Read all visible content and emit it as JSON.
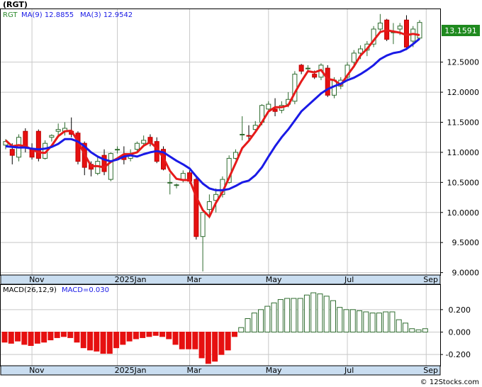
{
  "chart_data": [
    {
      "type": "candlestick",
      "title": "(RGT)",
      "legend": [
        {
          "label": "RGT",
          "color": "#2e8b2e"
        },
        {
          "label": "MA(9)",
          "value": "12.8855",
          "color": "#1a1ae6"
        },
        {
          "label": "MA(3)",
          "value": "12.9542",
          "color": "#1a1ae6"
        }
      ],
      "last_price": "13.1591",
      "y_ticks": [
        "9.0000",
        "9.5000",
        "10.0000",
        "10.5000",
        "11.0000",
        "11.5000",
        "12.0000",
        "12.5000"
      ],
      "ylim": [
        8.96,
        13.38
      ],
      "x_labels": [
        "Nov",
        "2025Jan",
        "Mar",
        "May",
        "Jul",
        "Sep"
      ],
      "candles": [
        [
          11.12,
          11.22,
          11.05,
          11.18
        ],
        [
          11.05,
          11.15,
          10.8,
          10.95
        ],
        [
          10.92,
          11.3,
          10.85,
          11.25
        ],
        [
          11.35,
          11.4,
          11.0,
          11.1
        ],
        [
          11.05,
          11.15,
          10.88,
          10.92
        ],
        [
          11.35,
          11.38,
          10.85,
          10.9
        ],
        [
          10.9,
          11.2,
          10.88,
          11.15
        ],
        [
          11.25,
          11.3,
          11.18,
          11.28
        ],
        [
          11.35,
          11.48,
          11.28,
          11.38
        ],
        [
          11.35,
          11.5,
          11.28,
          11.4
        ],
        [
          11.35,
          11.58,
          11.25,
          11.3
        ],
        [
          11.32,
          11.35,
          10.8,
          10.85
        ],
        [
          11.15,
          11.18,
          10.62,
          10.75
        ],
        [
          10.8,
          10.85,
          10.6,
          10.72
        ],
        [
          10.65,
          10.95,
          10.62,
          10.85
        ],
        [
          10.95,
          11.05,
          10.62,
          10.68
        ],
        [
          10.55,
          11.0,
          10.52,
          10.98
        ],
        [
          11.05,
          11.1,
          10.98,
          11.05
        ],
        [
          10.95,
          11.1,
          10.8,
          10.88
        ],
        [
          10.9,
          11.05,
          10.85,
          10.98
        ],
        [
          11.05,
          11.18,
          11.0,
          11.15
        ],
        [
          11.15,
          11.28,
          11.1,
          11.2
        ],
        [
          11.25,
          11.3,
          11.1,
          11.15
        ],
        [
          11.18,
          11.25,
          10.82,
          10.85
        ],
        [
          11.05,
          11.1,
          10.7,
          10.72
        ],
        [
          10.5,
          10.65,
          10.3,
          10.5
        ],
        [
          10.45,
          10.48,
          10.4,
          10.46
        ],
        [
          10.55,
          10.7,
          10.5,
          10.65
        ],
        [
          10.66,
          10.7,
          10.48,
          10.52
        ],
        [
          10.55,
          10.6,
          9.55,
          9.6
        ],
        [
          9.6,
          10.0,
          9.02,
          10.0
        ],
        [
          10.05,
          10.3,
          9.9,
          10.18
        ],
        [
          10.2,
          10.4,
          10.0,
          10.3
        ],
        [
          10.3,
          10.6,
          10.25,
          10.55
        ],
        [
          10.5,
          10.95,
          10.48,
          10.9
        ],
        [
          10.9,
          11.05,
          10.88,
          11.0
        ],
        [
          11.3,
          11.6,
          11.2,
          11.3
        ],
        [
          11.28,
          11.45,
          11.2,
          11.27
        ],
        [
          11.38,
          11.52,
          11.35,
          11.45
        ],
        [
          11.5,
          11.8,
          11.45,
          11.78
        ],
        [
          11.72,
          11.85,
          11.7,
          11.8
        ],
        [
          11.72,
          11.9,
          11.6,
          11.68
        ],
        [
          11.7,
          11.85,
          11.65,
          11.78
        ],
        [
          11.8,
          12.0,
          11.75,
          11.88
        ],
        [
          11.85,
          12.35,
          11.8,
          12.3
        ],
        [
          12.45,
          12.47,
          12.3,
          12.35
        ],
        [
          12.4,
          12.45,
          12.35,
          12.4
        ],
        [
          12.3,
          12.36,
          12.22,
          12.25
        ],
        [
          12.25,
          12.48,
          12.2,
          12.45
        ],
        [
          12.4,
          12.45,
          11.92,
          11.95
        ],
        [
          11.95,
          12.25,
          11.9,
          12.2
        ],
        [
          12.1,
          12.25,
          12.05,
          12.2
        ],
        [
          12.25,
          12.5,
          12.2,
          12.45
        ],
        [
          12.5,
          12.7,
          12.45,
          12.65
        ],
        [
          12.65,
          12.78,
          12.55,
          12.72
        ],
        [
          12.7,
          12.85,
          12.6,
          12.8
        ],
        [
          12.8,
          13.1,
          12.75,
          13.05
        ],
        [
          13.05,
          13.3,
          13.0,
          13.15
        ],
        [
          13.2,
          13.22,
          12.85,
          12.88
        ],
        [
          13.0,
          13.15,
          12.8,
          13.0
        ],
        [
          13.05,
          13.15,
          12.95,
          13.1
        ],
        [
          13.2,
          13.28,
          12.7,
          12.75
        ],
        [
          12.85,
          13.1,
          12.75,
          13.05
        ],
        [
          12.9,
          13.2,
          12.88,
          13.16
        ]
      ],
      "series": [
        {
          "name": "MA(9)",
          "color": "#1a1ae6",
          "values": [
            11.1,
            11.09,
            11.08,
            11.08,
            11.06,
            11.05,
            11.06,
            11.09,
            11.14,
            11.22,
            11.22,
            11.18,
            11.1,
            11.0,
            10.93,
            10.88,
            10.85,
            10.88,
            10.93,
            10.95,
            10.93,
            10.97,
            11.0,
            11.02,
            11.0,
            10.93,
            10.86,
            10.8,
            10.73,
            10.6,
            10.48,
            10.4,
            10.37,
            10.37,
            10.39,
            10.44,
            10.5,
            10.53,
            10.62,
            10.75,
            10.93,
            11.1,
            11.25,
            11.38,
            11.53,
            11.68,
            11.78,
            11.88,
            11.98,
            12.05,
            12.1,
            12.14,
            12.2,
            12.24,
            12.3,
            12.37,
            12.45,
            12.55,
            12.61,
            12.65,
            12.67,
            12.72,
            12.8,
            12.89
          ]
        },
        {
          "name": "MA(3)",
          "color": "#e61a1a",
          "values": [
            11.2,
            11.1,
            11.12,
            11.1,
            11.05,
            11.0,
            10.99,
            11.11,
            11.27,
            11.35,
            11.36,
            11.18,
            10.97,
            10.77,
            10.77,
            10.75,
            10.84,
            10.9,
            10.97,
            10.97,
            11.0,
            11.11,
            11.17,
            11.07,
            10.91,
            10.69,
            10.56,
            10.54,
            10.54,
            10.26,
            10.04,
            9.93,
            10.16,
            10.34,
            10.58,
            10.82,
            11.07,
            11.19,
            11.34,
            11.5,
            11.68,
            11.75,
            11.75,
            11.78,
            11.99,
            12.18,
            12.35,
            12.33,
            12.37,
            12.22,
            12.2,
            12.12,
            12.28,
            12.43,
            12.61,
            12.72,
            12.86,
            13.0,
            13.03,
            13.01,
            12.99,
            12.95,
            12.97,
            12.95
          ]
        }
      ]
    },
    {
      "type": "bar",
      "title": "MACD(26,12,9)",
      "legend": [
        {
          "label": "MACD(26,12,9)",
          "color": "#1a1ae6"
        },
        {
          "label": "MACD=0.030",
          "color": "#1a1ae6"
        }
      ],
      "y_ticks": [
        "0.200",
        "0.000",
        "-0.200"
      ],
      "ylim": [
        -0.3,
        0.42
      ],
      "x_labels": [
        "Nov",
        "2025Jan",
        "Mar",
        "May",
        "Jul",
        "Sep"
      ],
      "values": [
        -0.09,
        -0.1,
        -0.08,
        -0.11,
        -0.12,
        -0.1,
        -0.09,
        -0.07,
        -0.05,
        -0.04,
        -0.05,
        -0.09,
        -0.14,
        -0.16,
        -0.17,
        -0.19,
        -0.19,
        -0.14,
        -0.11,
        -0.08,
        -0.06,
        -0.05,
        -0.04,
        -0.03,
        -0.04,
        -0.06,
        -0.11,
        -0.15,
        -0.15,
        -0.15,
        -0.23,
        -0.28,
        -0.26,
        -0.2,
        -0.16,
        -0.04,
        0.04,
        0.12,
        0.17,
        0.2,
        0.23,
        0.26,
        0.29,
        0.3,
        0.3,
        0.3,
        0.33,
        0.35,
        0.34,
        0.32,
        0.28,
        0.22,
        0.2,
        0.2,
        0.19,
        0.18,
        0.17,
        0.17,
        0.18,
        0.18,
        0.11,
        0.08,
        0.03,
        0.02,
        0.03
      ]
    }
  ],
  "watermark": "© 12Stocks.com"
}
